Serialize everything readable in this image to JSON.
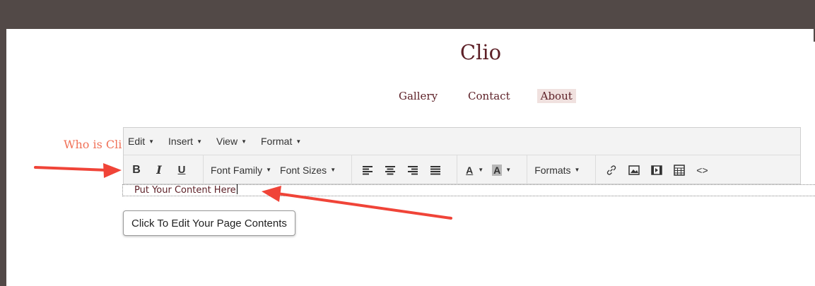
{
  "site": {
    "title": "Clio",
    "nav": [
      {
        "label": "Gallery",
        "active": false
      },
      {
        "label": "Contact",
        "active": false
      },
      {
        "label": "About",
        "active": true
      }
    ],
    "heading_partial": "Who is Cli"
  },
  "editor": {
    "menubar": [
      "Edit",
      "Insert",
      "View",
      "Format"
    ],
    "toolbar": {
      "bold": "B",
      "italic": "I",
      "underline": "U",
      "font_family": "Font Family",
      "font_sizes": "Font Sizes",
      "text_color": "A",
      "bg_color": "A",
      "formats": "Formats",
      "source": "<>"
    },
    "icons": [
      "align-left-icon",
      "align-center-icon",
      "align-right-icon",
      "align-justify-icon",
      "link-icon",
      "image-icon",
      "media-icon",
      "table-icon",
      "code-icon"
    ],
    "content": "Put Your Content Here"
  },
  "tooltip": "Click To Edit Your Page Contents",
  "colors": {
    "frame": "#524947",
    "brand": "#5c1f26",
    "accent": "#f07157",
    "arrow": "#f04438",
    "nav_active_bg": "#f0e1df"
  }
}
